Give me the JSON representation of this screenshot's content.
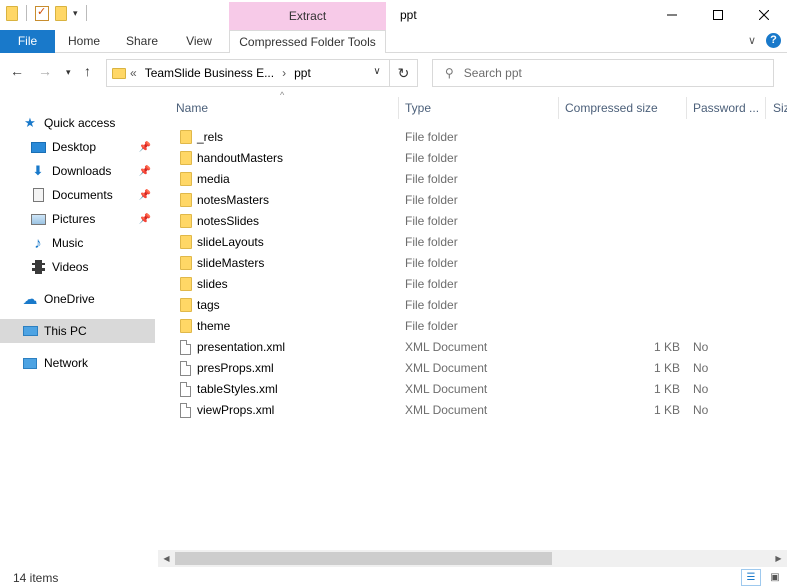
{
  "window": {
    "title": "ppt",
    "context_tab_group": "Extract"
  },
  "ribbon": {
    "file": "File",
    "home": "Home",
    "share": "Share",
    "view": "View",
    "context_tab": "Compressed Folder Tools"
  },
  "address": {
    "overflow": "«",
    "segment1": "TeamSlide Business E...",
    "separator": "›",
    "segment2": "ppt",
    "search_placeholder": "Search ppt"
  },
  "sidebar": {
    "quick_access": "Quick access",
    "desktop": "Desktop",
    "downloads": "Downloads",
    "documents": "Documents",
    "pictures": "Pictures",
    "music": "Music",
    "videos": "Videos",
    "onedrive": "OneDrive",
    "this_pc": "This PC",
    "network": "Network"
  },
  "columns": {
    "name": "Name",
    "type": "Type",
    "compressed_size": "Compressed size",
    "password": "Password ...",
    "size": "Siz"
  },
  "files": [
    {
      "name": "_rels",
      "type": "File folder",
      "size": "",
      "password": "",
      "kind": "folder"
    },
    {
      "name": "handoutMasters",
      "type": "File folder",
      "size": "",
      "password": "",
      "kind": "folder"
    },
    {
      "name": "media",
      "type": "File folder",
      "size": "",
      "password": "",
      "kind": "folder"
    },
    {
      "name": "notesMasters",
      "type": "File folder",
      "size": "",
      "password": "",
      "kind": "folder"
    },
    {
      "name": "notesSlides",
      "type": "File folder",
      "size": "",
      "password": "",
      "kind": "folder"
    },
    {
      "name": "slideLayouts",
      "type": "File folder",
      "size": "",
      "password": "",
      "kind": "folder"
    },
    {
      "name": "slideMasters",
      "type": "File folder",
      "size": "",
      "password": "",
      "kind": "folder"
    },
    {
      "name": "slides",
      "type": "File folder",
      "size": "",
      "password": "",
      "kind": "folder"
    },
    {
      "name": "tags",
      "type": "File folder",
      "size": "",
      "password": "",
      "kind": "folder"
    },
    {
      "name": "theme",
      "type": "File folder",
      "size": "",
      "password": "",
      "kind": "folder"
    },
    {
      "name": "presentation.xml",
      "type": "XML Document",
      "size": "1 KB",
      "password": "No",
      "kind": "file"
    },
    {
      "name": "presProps.xml",
      "type": "XML Document",
      "size": "1 KB",
      "password": "No",
      "kind": "file"
    },
    {
      "name": "tableStyles.xml",
      "type": "XML Document",
      "size": "1 KB",
      "password": "No",
      "kind": "file"
    },
    {
      "name": "viewProps.xml",
      "type": "XML Document",
      "size": "1 KB",
      "password": "No",
      "kind": "file"
    }
  ],
  "status": {
    "item_count": "14 items"
  },
  "colors": {
    "accent": "#1979ca",
    "context_tab": "#f7cae8",
    "selected_nav": "#d9d9d9",
    "folder": "#ffd766"
  }
}
